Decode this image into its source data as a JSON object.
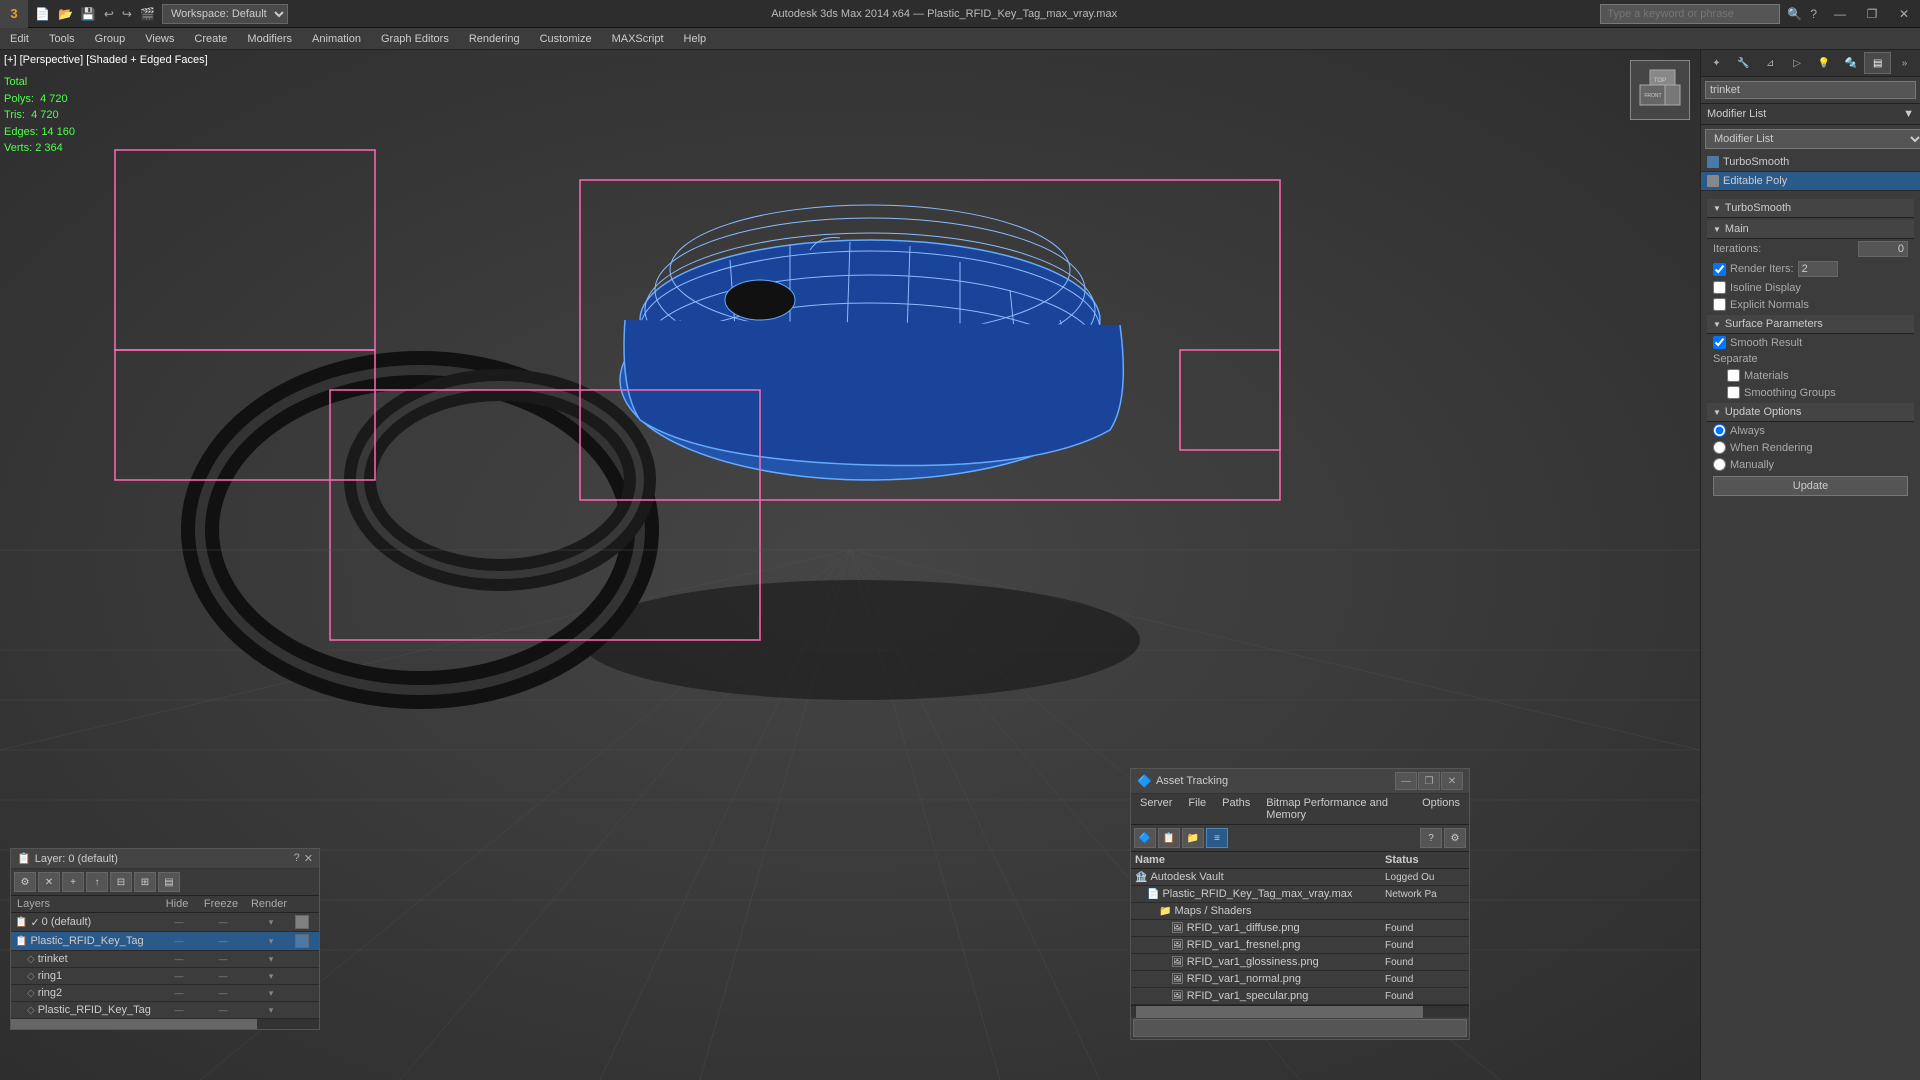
{
  "titleBar": {
    "appName": "3",
    "title": "Autodesk 3ds Max 2014 x64",
    "filename": "Plastic_RFID_Key_Tag_max_vray.max",
    "workspaceLabel": "Workspace: Default",
    "searchPlaceholder": "Type a keyword or phrase",
    "winControls": {
      "minimize": "—",
      "restore": "❐",
      "close": "✕"
    }
  },
  "menuBar": {
    "items": [
      "Edit",
      "Tools",
      "Group",
      "Views",
      "Create",
      "Modifiers",
      "Animation",
      "Graph Editors",
      "Rendering",
      "Customize",
      "MAXScript",
      "Help"
    ]
  },
  "viewport": {
    "label": "[+] [Perspective] [Shaded + Edged Faces]",
    "stats": {
      "totalLabel": "Total",
      "polys": "4 720",
      "tris": "4 720",
      "edges": "14 160",
      "verts": "2 364"
    }
  },
  "rightPanel": {
    "objectName": "trinket",
    "modifierListLabel": "Modifier List",
    "modifiers": [
      {
        "name": "TurboSmooth",
        "type": "blue"
      },
      {
        "name": "Editable Poly",
        "type": "normal"
      }
    ],
    "turboSmooth": {
      "title": "TurboSmooth",
      "main": {
        "label": "Main",
        "iterationsLabel": "Iterations:",
        "iterationsValue": "0",
        "renderItersLabel": "Render Iters:",
        "renderItersValue": "2",
        "isolineDisplay": "Isoline Display",
        "explicitNormals": "Explicit Normals"
      },
      "surface": {
        "label": "Surface Parameters",
        "smoothResult": "Smooth Result",
        "separateLabel": "Separate",
        "materials": "Materials",
        "smoothingGroups": "Smoothing Groups"
      },
      "update": {
        "label": "Update Options",
        "always": "Always",
        "whenRendering": "When Rendering",
        "manually": "Manually",
        "updateBtn": "Update"
      }
    }
  },
  "layerPanel": {
    "title": "Layer: 0 (default)",
    "columns": {
      "name": "Layers",
      "hide": "Hide",
      "freeze": "Freeze",
      "render": "Render"
    },
    "layers": [
      {
        "id": "layer0",
        "indent": 0,
        "name": "0 (default)",
        "isChecked": true,
        "hide": "—",
        "freeze": "—",
        "render": "▾",
        "colorHex": "#808080",
        "type": "layer"
      },
      {
        "id": "plastic",
        "indent": 0,
        "name": "Plastic_RFID_Key_Tag",
        "isChecked": false,
        "hide": "—",
        "freeze": "—",
        "render": "▾",
        "colorHex": "#4a7aaa",
        "type": "layer",
        "active": true
      },
      {
        "id": "trinket",
        "indent": 1,
        "name": "trinket",
        "isChecked": false,
        "hide": "—",
        "freeze": "—",
        "render": "▾",
        "colorHex": "",
        "type": "object"
      },
      {
        "id": "ring1",
        "indent": 1,
        "name": "ring1",
        "isChecked": false,
        "hide": "—",
        "freeze": "—",
        "render": "▾",
        "colorHex": "",
        "type": "object"
      },
      {
        "id": "ring2",
        "indent": 1,
        "name": "ring2",
        "isChecked": false,
        "hide": "—",
        "freeze": "—",
        "render": "▾",
        "colorHex": "",
        "type": "object"
      },
      {
        "id": "plasticTag2",
        "indent": 1,
        "name": "Plastic_RFID_Key_Tag",
        "isChecked": false,
        "hide": "—",
        "freeze": "—",
        "render": "▾",
        "colorHex": "",
        "type": "object"
      }
    ]
  },
  "assetPanel": {
    "title": "Asset Tracking",
    "menuItems": [
      "Server",
      "File",
      "Paths",
      "Bitmap Performance and Memory",
      "Options"
    ],
    "columns": {
      "name": "Name",
      "status": "Status"
    },
    "items": [
      {
        "id": "vault",
        "indent": 0,
        "name": "Autodesk Vault",
        "status": "Logged Ou",
        "icon": "🏦",
        "type": "vault"
      },
      {
        "id": "maxfile",
        "indent": 1,
        "name": "Plastic_RFID_Key_Tag_max_vray.max",
        "status": "Network Pa",
        "icon": "📄",
        "type": "file"
      },
      {
        "id": "maps",
        "indent": 2,
        "name": "Maps / Shaders",
        "status": "",
        "icon": "📁",
        "type": "folder"
      },
      {
        "id": "diffuse",
        "indent": 3,
        "name": "RFID_var1_diffuse.png",
        "status": "Found",
        "icon": "🖼",
        "type": "texture"
      },
      {
        "id": "fresnel",
        "indent": 3,
        "name": "RFID_var1_fresnel.png",
        "status": "Found",
        "icon": "🖼",
        "type": "texture"
      },
      {
        "id": "glossiness",
        "indent": 3,
        "name": "RFID_var1_glossiness.png",
        "status": "Found",
        "icon": "🖼",
        "type": "texture"
      },
      {
        "id": "normal",
        "indent": 3,
        "name": "RFID_var1_normal.png",
        "status": "Found",
        "icon": "🖼",
        "type": "texture"
      },
      {
        "id": "specular",
        "indent": 3,
        "name": "RFID_var1_specular.png",
        "status": "Found",
        "icon": "🖼",
        "type": "texture"
      }
    ]
  }
}
